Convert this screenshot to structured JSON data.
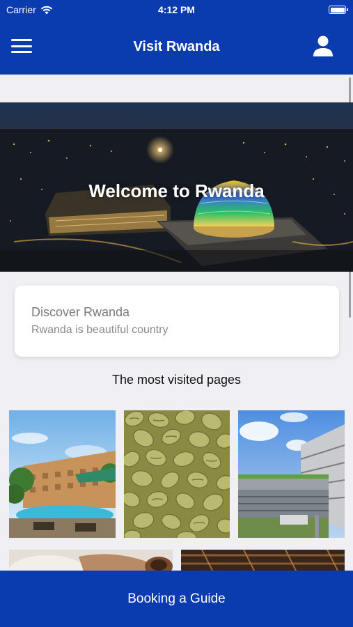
{
  "status": {
    "carrier": "Carrier",
    "time": "4:12 PM"
  },
  "nav": {
    "title": "Visit Rwanda"
  },
  "hero": {
    "title": "Welcome to Rwanda"
  },
  "card": {
    "title": "Discover Rwanda",
    "subtitle": "Rwanda is beautiful country"
  },
  "section": {
    "title": "The most visited pages"
  },
  "footer": {
    "button_label": "Booking a Guide"
  },
  "colors": {
    "brand": "#0a3cb0",
    "background": "#f0f0f4"
  }
}
